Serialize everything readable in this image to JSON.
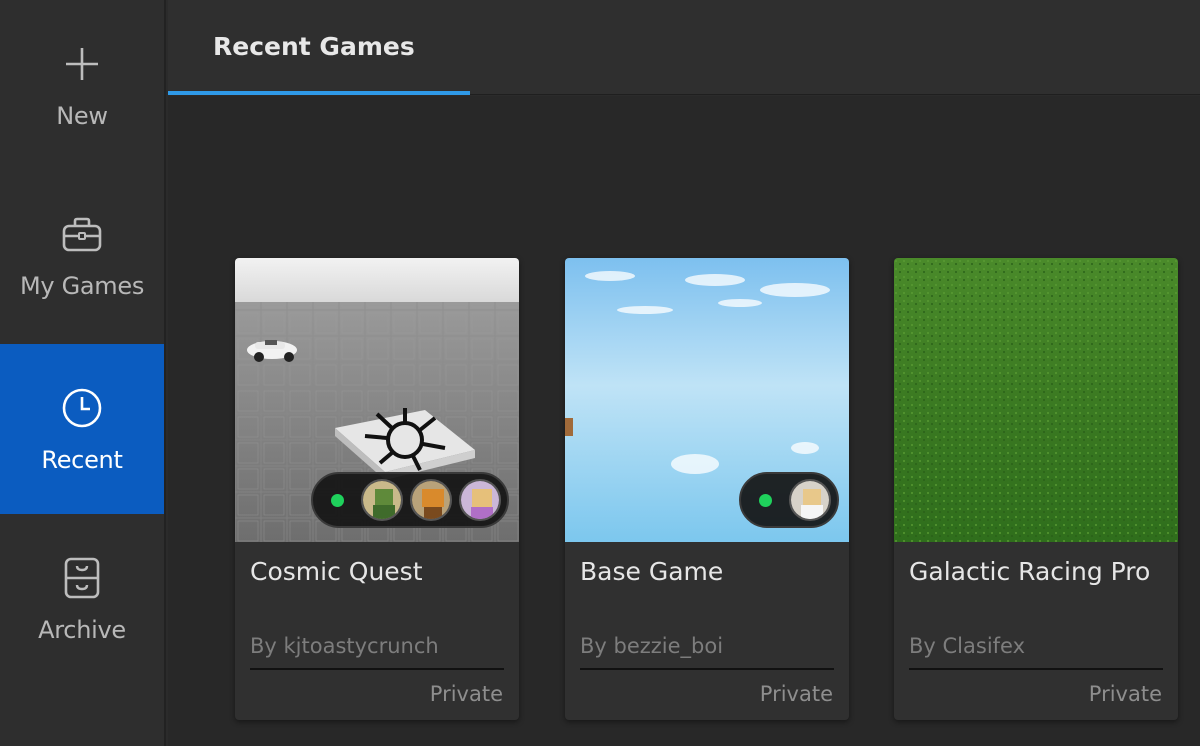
{
  "sidebar": {
    "items": [
      {
        "label": "New",
        "icon": "plus-icon"
      },
      {
        "label": "My Games",
        "icon": "briefcase-icon"
      },
      {
        "label": "Recent",
        "icon": "clock-icon",
        "active": true
      },
      {
        "label": "Archive",
        "icon": "archive-icon"
      }
    ],
    "active_color": "#0b5cc0"
  },
  "tabs": [
    {
      "label": "Recent Games",
      "active": true
    }
  ],
  "accent_color": "#2f9ae8",
  "games": [
    {
      "title": "Cosmic Quest",
      "author": "By kjtoastycrunch",
      "privacy": "Private",
      "online_indicator": "online",
      "player_avatars": [
        "player-avatar-1",
        "player-avatar-2",
        "player-avatar-3"
      ]
    },
    {
      "title": "Base Game",
      "author": "By bezzie_boi",
      "privacy": "Private",
      "online_indicator": "online",
      "player_avatars": [
        "player-avatar-1"
      ]
    },
    {
      "title": "Galactic Racing Pro",
      "author": "By Clasifex",
      "privacy": "Private"
    }
  ]
}
